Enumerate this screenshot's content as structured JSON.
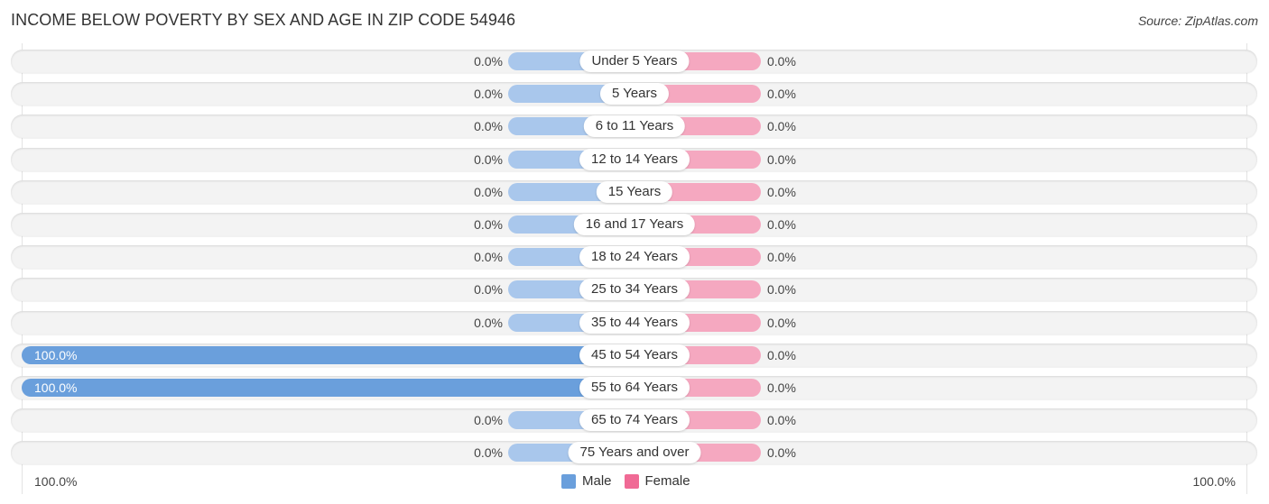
{
  "header": {
    "title": "INCOME BELOW POVERTY BY SEX AND AGE IN ZIP CODE 54946",
    "source": "Source: ZipAtlas.com"
  },
  "colors": {
    "male_full": "#6a9fdc",
    "male_stub": "#a9c7ec",
    "female_full": "#f06a95",
    "female_stub": "#f5a8c0"
  },
  "chart_data": {
    "type": "bar",
    "orientation": "horizontal-diverging",
    "title": "INCOME BELOW POVERTY BY SEX AND AGE IN ZIP CODE 54946",
    "categories": [
      "Under 5 Years",
      "5 Years",
      "6 to 11 Years",
      "12 to 14 Years",
      "15 Years",
      "16 and 17 Years",
      "18 to 24 Years",
      "25 to 34 Years",
      "35 to 44 Years",
      "45 to 54 Years",
      "55 to 64 Years",
      "65 to 74 Years",
      "75 Years and over"
    ],
    "series": [
      {
        "name": "Male",
        "values": [
          0.0,
          0.0,
          0.0,
          0.0,
          0.0,
          0.0,
          0.0,
          0.0,
          0.0,
          100.0,
          100.0,
          0.0,
          0.0
        ],
        "labels": [
          "0.0%",
          "0.0%",
          "0.0%",
          "0.0%",
          "0.0%",
          "0.0%",
          "0.0%",
          "0.0%",
          "0.0%",
          "100.0%",
          "100.0%",
          "0.0%",
          "0.0%"
        ]
      },
      {
        "name": "Female",
        "values": [
          0.0,
          0.0,
          0.0,
          0.0,
          0.0,
          0.0,
          0.0,
          0.0,
          0.0,
          0.0,
          0.0,
          0.0,
          0.0
        ],
        "labels": [
          "0.0%",
          "0.0%",
          "0.0%",
          "0.0%",
          "0.0%",
          "0.0%",
          "0.0%",
          "0.0%",
          "0.0%",
          "0.0%",
          "0.0%",
          "0.0%",
          "0.0%"
        ]
      }
    ],
    "xlim": [
      -100,
      100
    ],
    "axis_labels": {
      "left": "100.0%",
      "right": "100.0%"
    },
    "legend": {
      "position": "bottom-center",
      "items": [
        "Male",
        "Female"
      ]
    },
    "grid": false
  }
}
